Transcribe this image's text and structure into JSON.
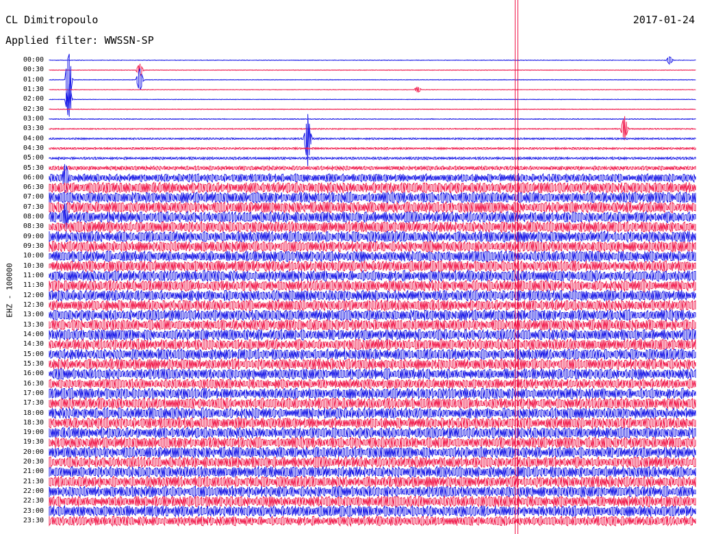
{
  "header": {
    "station": "CL Dimitropoulo",
    "filter_label": "Applied filter: WWSSN-SP",
    "date": "2017-01-24"
  },
  "colors": {
    "blue": "#1515e6",
    "red": "#f0184a"
  },
  "chart_data": {
    "type": "line",
    "title": "CL Dimitropoulo",
    "subtitle": "Applied filter: WWSSN-SP",
    "date": "2017-01-24",
    "ylabel": "EHZ - 100000",
    "row_labels": [
      "00:00",
      "00:30",
      "01:00",
      "01:30",
      "02:00",
      "02:30",
      "03:00",
      "03:30",
      "04:00",
      "04:30",
      "05:00",
      "05:30",
      "06:00",
      "06:30",
      "07:00",
      "07:30",
      "08:00",
      "08:30",
      "09:00",
      "09:30",
      "10:00",
      "10:30",
      "11:00",
      "11:30",
      "12:00",
      "12:30",
      "13:00",
      "13:30",
      "14:00",
      "14:30",
      "15:00",
      "15:30",
      "16:00",
      "16:30",
      "17:00",
      "17:30",
      "18:00",
      "18:30",
      "19:00",
      "19:30",
      "20:00",
      "20:30",
      "21:00",
      "21:30",
      "22:00",
      "22:30",
      "23:00",
      "23:30"
    ],
    "row_colors": [
      "blue",
      "red"
    ],
    "noise_level": [
      0.3,
      0.3,
      0.3,
      0.3,
      0.3,
      0.4,
      0.5,
      0.8,
      1.2,
      1.5,
      1.8,
      3,
      6,
      8,
      8,
      8,
      8,
      8,
      8,
      8,
      8,
      8,
      8,
      8,
      8,
      8,
      8,
      8,
      8,
      8,
      8,
      8,
      8,
      7,
      8,
      8,
      8,
      8,
      8,
      8,
      8,
      8,
      8,
      8,
      8,
      8,
      8,
      7
    ],
    "events": [
      {
        "row": 0,
        "x": 0.96,
        "amplitude": 6
      },
      {
        "row": 1,
        "x": 0.14,
        "amplitude": 10
      },
      {
        "row": 2,
        "x": 0.14,
        "amplitude": 18
      },
      {
        "row": 3,
        "x": 0.57,
        "amplitude": 5
      },
      {
        "row": 2,
        "x": 0.03,
        "amplitude": 45
      },
      {
        "row": 4,
        "x": 0.03,
        "amplitude": 30
      },
      {
        "row": 8,
        "x": 0.4,
        "amplitude": 40
      },
      {
        "row": 7,
        "x": 0.89,
        "amplitude": 20
      },
      {
        "row": 23,
        "x": 0.92,
        "amplitude": 12
      },
      {
        "row": 12,
        "x": 0.025,
        "amplitude": 25
      },
      {
        "row": 16,
        "x": 0.025,
        "amplitude": 25
      }
    ],
    "vertical_marker_x": 0.723
  }
}
